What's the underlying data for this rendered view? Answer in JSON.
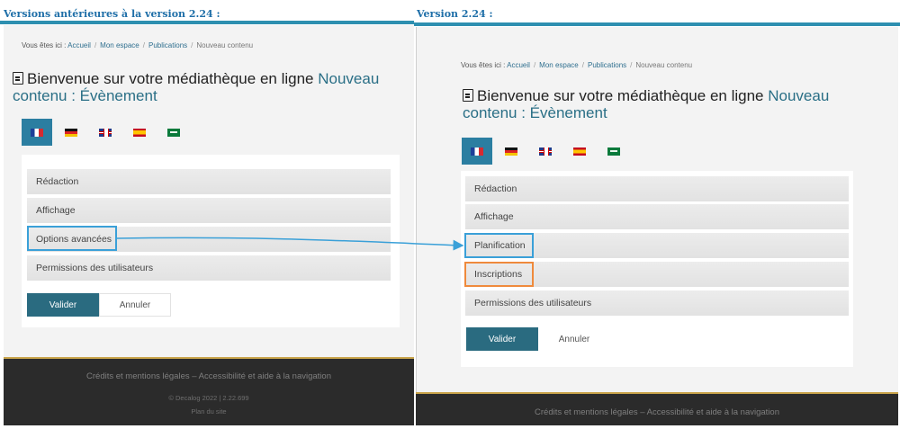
{
  "left": {
    "heading": "Versions antérieures à la version 2.24 :",
    "breadcrumb": {
      "prefix": "Vous êtes ici :",
      "items": [
        "Accueil",
        "Mon espace",
        "Publications"
      ],
      "current": "Nouveau contenu"
    },
    "title": {
      "main": "Bienvenue sur votre médiathèque en ligne",
      "accent_line1": "Nouveau",
      "accent_line2": "contenu : Évènement"
    },
    "sections": [
      "Rédaction",
      "Affichage",
      "Options avancées",
      "Permissions des utilisateurs"
    ],
    "buttons": {
      "submit": "Valider",
      "cancel": "Annuler"
    },
    "footer": {
      "links": "Crédits et mentions légales – Accessibilité et aide à la navigation",
      "copyright": "© Decalog 2022 | 2.22.699",
      "sitemap": "Plan du site"
    }
  },
  "right": {
    "heading": "Version 2.24 :",
    "breadcrumb": {
      "prefix": "Vous êtes ici :",
      "items": [
        "Accueil",
        "Mon espace",
        "Publications"
      ],
      "current": "Nouveau contenu"
    },
    "title": {
      "main": "Bienvenue sur votre médiathèque en ligne",
      "accent_line1": "Nouveau",
      "accent_line2": "contenu : Évènement"
    },
    "sections": [
      "Rédaction",
      "Affichage",
      "Planification",
      "Inscriptions",
      "Permissions des utilisateurs"
    ],
    "buttons": {
      "submit": "Valider",
      "cancel": "Annuler"
    },
    "footer": {
      "links": "Crédits et mentions légales – Accessibilité et aide à la navigation"
    }
  },
  "languages": [
    "fr",
    "de",
    "gb",
    "es",
    "sa"
  ],
  "colors": {
    "accent": "#2a6b80",
    "highlight_blue": "#3aa0d8",
    "highlight_orange": "#ef8a3c",
    "heading": "#1f6fa8"
  }
}
